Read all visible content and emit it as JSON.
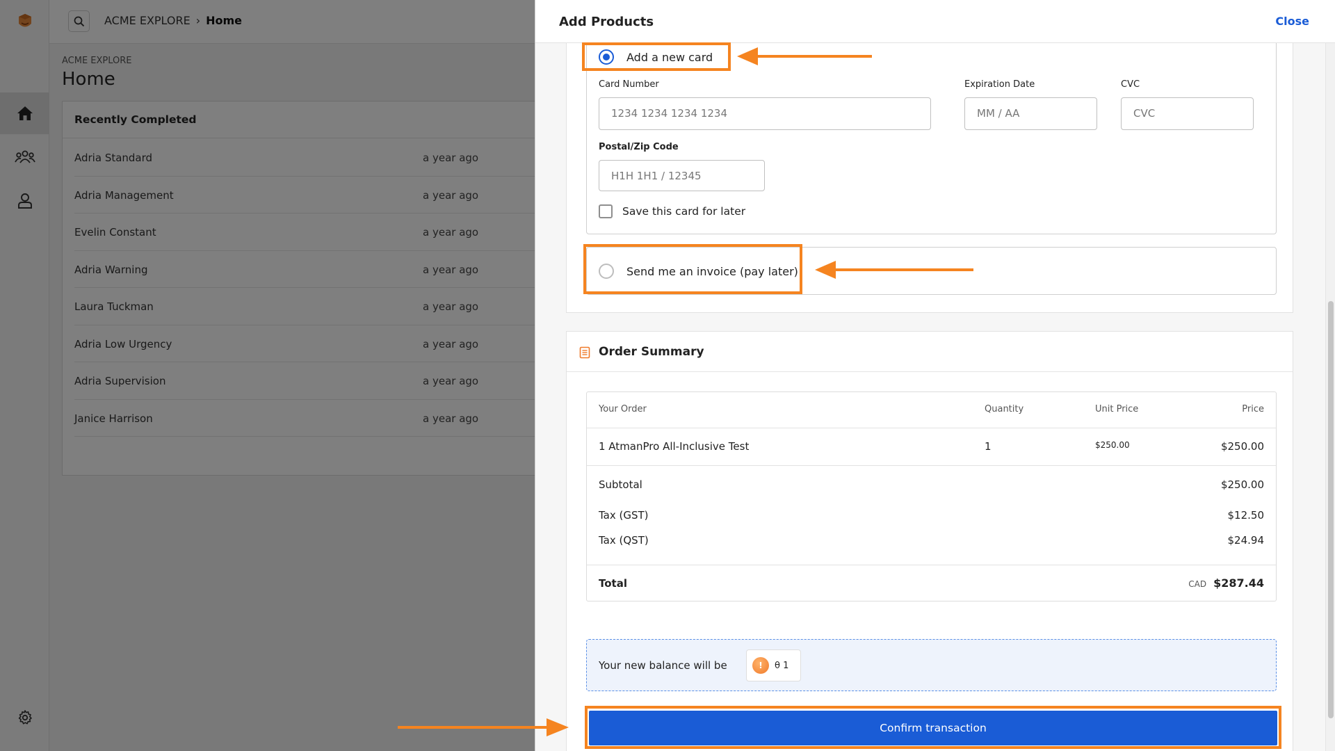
{
  "app": {
    "breadcrumb": {
      "root": "ACME EXPLORE",
      "current": "Home"
    }
  },
  "main": {
    "kicker": "ACME EXPLORE",
    "title": "Home",
    "recent": {
      "title": "Recently Completed",
      "items": [
        {
          "name": "Adria Standard",
          "time": "a year ago"
        },
        {
          "name": "Adria Management",
          "time": "a year ago"
        },
        {
          "name": "Evelin Constant",
          "time": "a year ago"
        },
        {
          "name": "Adria Warning",
          "time": "a year ago"
        },
        {
          "name": "Laura Tuckman",
          "time": "a year ago"
        },
        {
          "name": "Adria Low Urgency",
          "time": "a year ago"
        },
        {
          "name": "Adria Supervision",
          "time": "a year ago"
        },
        {
          "name": "Janice Harrison",
          "time": "a year ago"
        }
      ]
    }
  },
  "panel": {
    "title": "Add Products",
    "close_label": "Close",
    "payment": {
      "new_card_label": "Add a new card",
      "card_number_label": "Card Number",
      "card_number_placeholder": "1234 1234 1234 1234",
      "expiration_label": "Expiration Date",
      "expiration_placeholder": "MM / AA",
      "cvc_label": "CVC",
      "cvc_placeholder": "CVC",
      "postal_label": "Postal/Zip Code",
      "postal_placeholder": "H1H 1H1 / 12345",
      "save_card_label": "Save this card for later",
      "invoice_label": "Send me an invoice (pay later)"
    },
    "summary": {
      "title": "Order Summary",
      "headers": {
        "order": "Your Order",
        "quantity": "Quantity",
        "unit_price": "Unit Price",
        "price": "Price"
      },
      "line": {
        "name": "1 AtmanPro All-Inclusive Test",
        "quantity": "1",
        "unit_price": "$250.00",
        "price": "$250.00"
      },
      "subtotal_label": "Subtotal",
      "subtotal": "$250.00",
      "tax_gst_label": "Tax (GST)",
      "tax_gst": "$12.50",
      "tax_qst_label": "Tax (QST)",
      "tax_qst": "$24.94",
      "total_label": "Total",
      "currency": "CAD",
      "total": "$287.44"
    },
    "balance": {
      "label": "Your new balance will be",
      "coin_symbol": "!",
      "value": "θ 1"
    },
    "confirm_label": "Confirm transaction"
  },
  "colors": {
    "accent": "#1a5cd6",
    "annotation": "#f58420",
    "coin": "#f07a2a"
  }
}
